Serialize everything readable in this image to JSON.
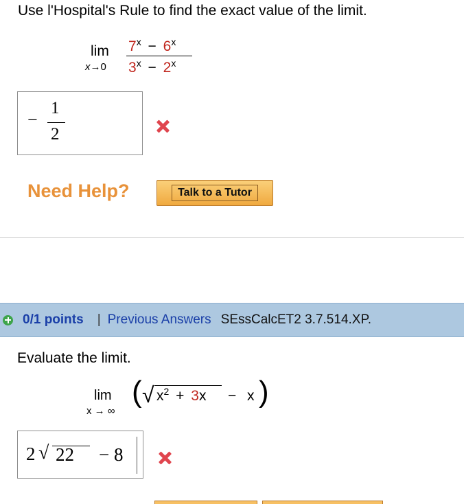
{
  "problem1": {
    "prompt": "Use l'Hospital's Rule to find the exact value of the limit.",
    "limit": {
      "word": "lim",
      "var": "x",
      "arrow": "→",
      "to": "0",
      "numerator": {
        "a": "7",
        "b": "6",
        "exp": "x",
        "op": "−"
      },
      "denominator": {
        "a": "3",
        "b": "2",
        "exp": "x",
        "op": "−"
      }
    },
    "answer": {
      "sign": "−",
      "numerator": "1",
      "denominator": "2"
    },
    "status": "incorrect"
  },
  "help": {
    "label": "Need Help?",
    "tutor_button": "Talk to a Tutor"
  },
  "problem2": {
    "header": {
      "points": "0/1 points",
      "separator": "|",
      "previous_answers": "Previous Answers",
      "code": "SEssCalcET2 3.7.514.XP."
    },
    "prompt": "Evaluate the limit.",
    "limit": {
      "word": "lim",
      "sub": "x → ∞",
      "lparen": "(",
      "rparen": ")",
      "radical": "√",
      "x": "x",
      "exp": "2",
      "plus": "+",
      "coef": "3",
      "minus": "−"
    },
    "answer": {
      "coef": "2",
      "radical": "√",
      "radicand": "22",
      "rest": "− 8"
    },
    "status": "incorrect"
  },
  "colors": {
    "red_coefficient": "#c0261d",
    "x_mark": "#e0454e",
    "need_help": "#e8923a",
    "header_bg": "#adc8e0",
    "link": "#1a3fa8"
  }
}
